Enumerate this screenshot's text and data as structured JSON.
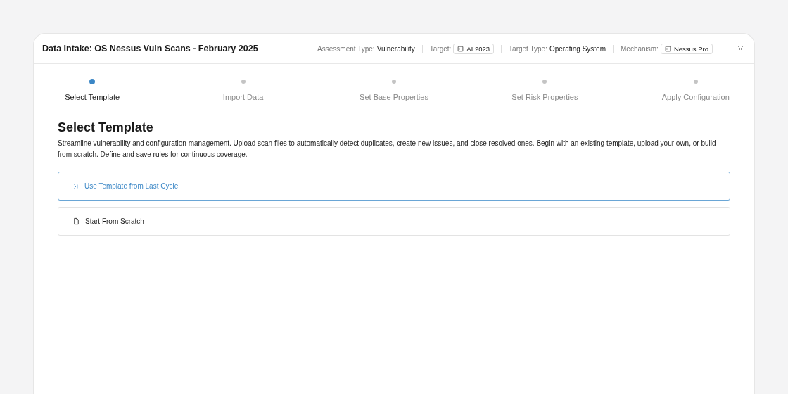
{
  "dialog": {
    "title": "Data Intake: OS Nessus Vuln Scans - February 2025",
    "meta": [
      {
        "label": "Assessment Type:",
        "value": "Vulnerability",
        "kind": "text"
      },
      {
        "label": "Target:",
        "value": "AL2023",
        "kind": "chip"
      },
      {
        "label": "Target Type:",
        "value": "Operating System",
        "kind": "text"
      },
      {
        "label": "Mechanism:",
        "value": "Nessus Pro",
        "kind": "chip"
      }
    ]
  },
  "steps": [
    {
      "label": "Select Template",
      "selected": true
    },
    {
      "label": "Import Data",
      "selected": false
    },
    {
      "label": "Set Base Properties",
      "selected": false
    },
    {
      "label": "Set Risk Properties",
      "selected": false
    },
    {
      "label": "Apply Configuration",
      "selected": false
    }
  ],
  "heading": "Select Template",
  "description": "Streamline vulnerability and configuration management. Upload scan files to automatically detect duplicates, create new issues, and close resolved ones. Begin with an existing template, upload your own, or build from scratch. Define and save rules for continuous coverage.",
  "options": [
    {
      "label": "Use Template from Last Cycle",
      "kind": "skip",
      "selected": true
    },
    {
      "label": "Start From Scratch",
      "kind": "file",
      "selected": false
    }
  ]
}
